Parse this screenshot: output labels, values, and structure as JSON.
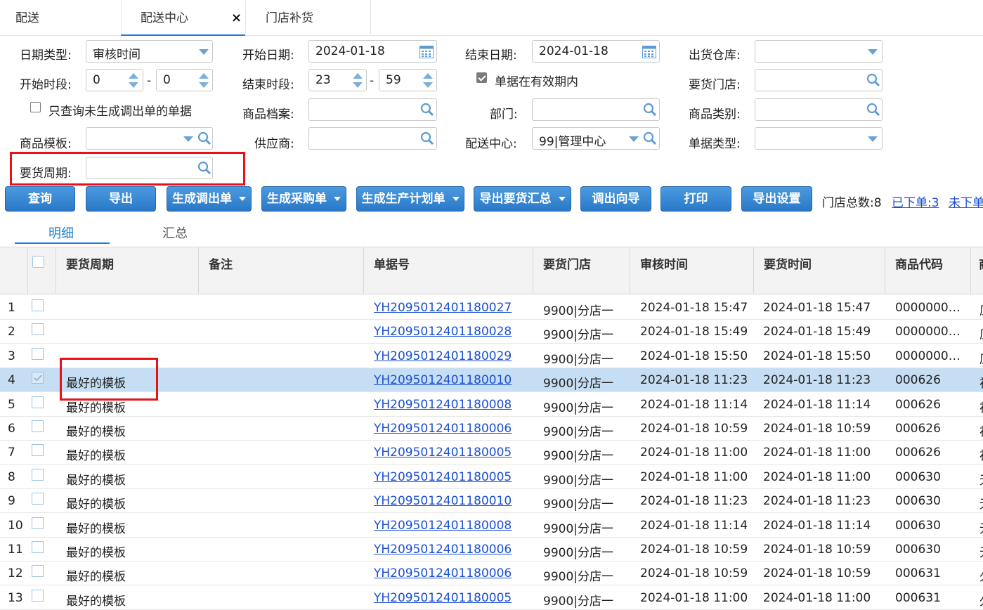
{
  "tabs": [
    {
      "label": "配送"
    },
    {
      "label": "配送中心",
      "active": true,
      "close": "×"
    },
    {
      "label": "门店补货"
    }
  ],
  "form": {
    "date_type_label": "日期类型:",
    "date_type_value": "审核时间",
    "start_date_label": "开始日期:",
    "start_date_value": "2024-01-18",
    "end_date_label": "结束日期:",
    "end_date_value": "2024-01-18",
    "warehouse_label": "出货仓库:",
    "warehouse_value": "",
    "start_period_label": "开始时段:",
    "start_hour": "0",
    "start_minute": "0",
    "end_period_label": "结束时段:",
    "end_hour": "23",
    "end_minute": "59",
    "dash": "-",
    "valid_period_label": "单据在有效期内",
    "valid_period_checked": true,
    "store_label": "要货门店:",
    "only_unbuilt_label": "只查询未生成调出单的单据",
    "only_unbuilt_checked": false,
    "product_file_label": "商品档案:",
    "dept_label": "部门:",
    "category_label": "商品类别:",
    "template_label": "商品模板:",
    "supplier_label": "供应商:",
    "dc_label": "配送中心:",
    "dc_value": "99|管理中心",
    "doc_type_label": "单据类型:",
    "cycle_label": "要货周期:"
  },
  "toolbar": {
    "query": "查询",
    "export": "导出",
    "gen_transfer": "生成调出单",
    "gen_purchase": "生成采购单",
    "gen_plan": "生成生产计划单",
    "export_summary": "导出要货汇总",
    "transfer_wizard": "调出向导",
    "print": "打印",
    "export_settings": "导出设置",
    "store_total": "门店总数:8",
    "ordered": "已下单:3",
    "not_ordered": "未下单"
  },
  "subtabs": {
    "detail": "明细",
    "summary": "汇总"
  },
  "colors": {
    "accent": "#1e7fd6",
    "button": "#2a78c7",
    "selected_row": "#c5def3",
    "highlight": "#e8111a",
    "link": "#1a4fd6"
  },
  "table": {
    "headers": [
      "要货周期",
      "备注",
      "单据号",
      "要货门店",
      "审核时间",
      "要货时间",
      "商品代码",
      "商"
    ],
    "rows": [
      {
        "n": "1",
        "cycle": "",
        "remark": "",
        "doc": "YH2095012401180027",
        "store": "9900|分店一",
        "audit": "2024-01-18 15:47",
        "req": "2024-01-18 15:47",
        "code": "0000000…",
        "extra": "原",
        "sel": false
      },
      {
        "n": "2",
        "cycle": "",
        "remark": "",
        "doc": "YH2095012401180028",
        "store": "9900|分店一",
        "audit": "2024-01-18 15:49",
        "req": "2024-01-18 15:49",
        "code": "0000000…",
        "extra": "原",
        "sel": false
      },
      {
        "n": "3",
        "cycle": "",
        "remark": "",
        "doc": "YH2095012401180029",
        "store": "9900|分店一",
        "audit": "2024-01-18 15:50",
        "req": "2024-01-18 15:50",
        "code": "0000000…",
        "extra": "原",
        "sel": false
      },
      {
        "n": "4",
        "cycle": "最好的模板",
        "remark": "",
        "doc": "YH2095012401180010",
        "store": "9900|分店一",
        "audit": "2024-01-18 11:23",
        "req": "2024-01-18 11:23",
        "code": "000626",
        "extra": "初",
        "sel": true
      },
      {
        "n": "5",
        "cycle": "最好的模板",
        "remark": "",
        "doc": "YH2095012401180008",
        "store": "9900|分店一",
        "audit": "2024-01-18 11:14",
        "req": "2024-01-18 11:14",
        "code": "000626",
        "extra": "初",
        "sel": false
      },
      {
        "n": "6",
        "cycle": "最好的模板",
        "remark": "",
        "doc": "YH2095012401180006",
        "store": "9900|分店一",
        "audit": "2024-01-18 10:59",
        "req": "2024-01-18 10:59",
        "code": "000626",
        "extra": "初",
        "sel": false
      },
      {
        "n": "7",
        "cycle": "最好的模板",
        "remark": "",
        "doc": "YH2095012401180005",
        "store": "9900|分店一",
        "audit": "2024-01-18 11:00",
        "req": "2024-01-18 11:00",
        "code": "000626",
        "extra": "初",
        "sel": false
      },
      {
        "n": "8",
        "cycle": "最好的模板",
        "remark": "",
        "doc": "YH2095012401180005",
        "store": "9900|分店一",
        "audit": "2024-01-18 11:00",
        "req": "2024-01-18 11:00",
        "code": "000630",
        "extra": "无",
        "sel": false
      },
      {
        "n": "9",
        "cycle": "最好的模板",
        "remark": "",
        "doc": "YH2095012401180010",
        "store": "9900|分店一",
        "audit": "2024-01-18 11:23",
        "req": "2024-01-18 11:23",
        "code": "000630",
        "extra": "无",
        "sel": false
      },
      {
        "n": "10",
        "cycle": "最好的模板",
        "remark": "",
        "doc": "YH2095012401180008",
        "store": "9900|分店一",
        "audit": "2024-01-18 11:14",
        "req": "2024-01-18 11:14",
        "code": "000630",
        "extra": "无",
        "sel": false
      },
      {
        "n": "11",
        "cycle": "最好的模板",
        "remark": "",
        "doc": "YH2095012401180006",
        "store": "9900|分店一",
        "audit": "2024-01-18 10:59",
        "req": "2024-01-18 10:59",
        "code": "000630",
        "extra": "无",
        "sel": false
      },
      {
        "n": "12",
        "cycle": "最好的模板",
        "remark": "",
        "doc": "YH2095012401180006",
        "store": "9900|分店一",
        "audit": "2024-01-18 10:59",
        "req": "2024-01-18 10:59",
        "code": "000631",
        "extra": "久",
        "sel": false
      },
      {
        "n": "13",
        "cycle": "最好的模板",
        "remark": "",
        "doc": "YH2095012401180005",
        "store": "9900|分店一",
        "audit": "2024-01-18 11:00",
        "req": "2024-01-18 11:00",
        "code": "000631",
        "extra": "久",
        "sel": false
      }
    ]
  }
}
